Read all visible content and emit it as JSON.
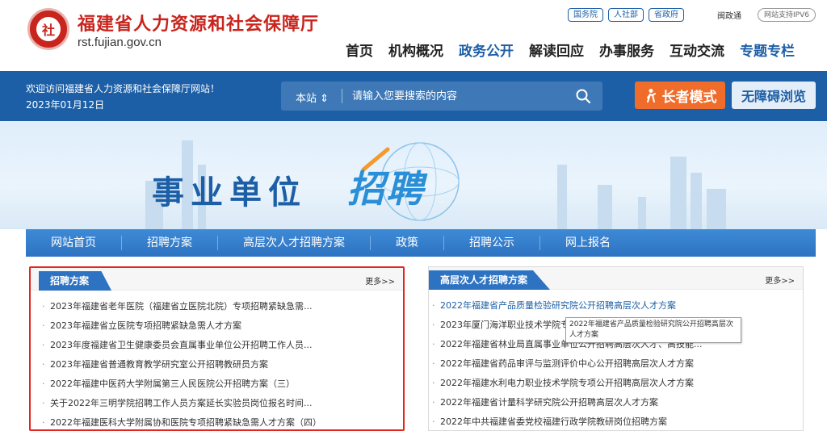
{
  "header": {
    "site_name": "福建省人力资源和社会保障厅",
    "domain": "rst.fujian.gov.cn",
    "emblem_text": "社",
    "top_links": [
      "国务院",
      "人社部",
      "省政府"
    ],
    "minzheng": "闽政通",
    "ipv6": "网站支持IPV6",
    "nav": [
      "首页",
      "机构概况",
      "政务公开",
      "解读回应",
      "办事服务",
      "互动交流",
      "专题专栏"
    ],
    "nav_active": "政务公开"
  },
  "bluebar": {
    "welcome": "欢迎访问福建省人力资源和社会保障厅网站！",
    "date": "2023年01月12日",
    "search_scope": "本站",
    "search_placeholder": "请输入您要搜索的内容",
    "elder_mode": "长者模式",
    "accessible": "无障碍浏览"
  },
  "banner": {
    "title_main": "事业单位",
    "title_accent": "招聘"
  },
  "subnav": [
    "网站首页",
    "招聘方案",
    "高层次人才招聘方案",
    "政策",
    "招聘公示",
    "网上报名"
  ],
  "left_panel": {
    "title": "招聘方案",
    "more": "更多>>",
    "items": [
      "2023年福建省老年医院（福建省立医院北院）专项招聘紧缺急需...",
      "2023年福建省立医院专项招聘紧缺急需人才方案",
      "2023年度福建省卫生健康委员会直属事业单位公开招聘工作人员...",
      "2023年福建省普通教育教学研究室公开招聘教研员方案",
      "2022年福建中医药大学附属第三人民医院公开招聘方案（三）",
      "关于2022年三明学院招聘工作人员方案延长实验员岗位报名时间...",
      "2022年福建医科大学附属协和医院专项招聘紧缺急需人才方案（四）"
    ]
  },
  "right_panel": {
    "title": "高层次人才招聘方案",
    "more": "更多>>",
    "items": [
      "2022年福建省产品质量检验研究院公开招聘高层次人才方案",
      "2023年厦门海洋职业技术学院专",
      "2022年福建省林业局直属事业单位公开招聘高层次人才、高技能...",
      "2022年福建省药品审评与监测评价中心公开招聘高层次人才方案",
      "2022年福建水利电力职业技术学院专项公开招聘高层次人才方案",
      "2022年福建省计量科学研究院公开招聘高层次人才方案",
      "2022年中共福建省委党校福建行政学院教研岗位招聘方案"
    ]
  },
  "tooltip": "2022年福建省产品质量检验研究院公开招聘高层次人才方案",
  "colors": {
    "brand_red": "#c8251d",
    "brand_blue": "#1d5fa6",
    "elder_orange": "#f06c2a",
    "highlight_border": "#e0281e"
  }
}
